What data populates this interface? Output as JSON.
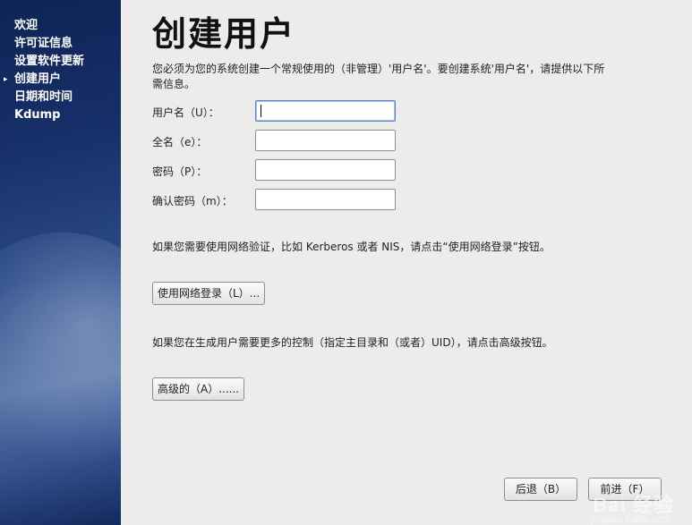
{
  "sidebar": {
    "items": [
      {
        "label": "欢迎",
        "current": false
      },
      {
        "label": "许可证信息",
        "current": false
      },
      {
        "label": "设置软件更新",
        "current": false
      },
      {
        "label": "创建用户",
        "current": true
      },
      {
        "label": "日期和时间",
        "current": false
      },
      {
        "label": "Kdump",
        "current": false
      }
    ],
    "current_marker": "▸"
  },
  "main": {
    "title": "创建用户",
    "intro": "您必须为您的系统创建一个常规使用的（非管理）'用户名'。要创建系统'用户名'，请提供以下所需信息。",
    "fields": {
      "username": {
        "label": "用户名（U）：",
        "value": ""
      },
      "fullname": {
        "label": "全名（e）：",
        "value": ""
      },
      "password": {
        "label": "密码（P）：",
        "value": ""
      },
      "confirm": {
        "label": "确认密码（m）：",
        "value": ""
      }
    },
    "network_note": "如果您需要使用网络验证，比如 Kerberos 或者 NIS，请点击“使用网络登录”按钮。",
    "network_button": "使用网络登录（L）...",
    "advanced_note": "如果您在生成用户需要更多的控制（指定主目录和（或者）UID），请点击高级按钮。",
    "advanced_button": "高级的（A）......"
  },
  "footer": {
    "back_label": "后退（B）",
    "forward_label": "前进（F）"
  },
  "watermark": {
    "text": "Bai 经验",
    "sub": "jingyan.baidu.com"
  }
}
